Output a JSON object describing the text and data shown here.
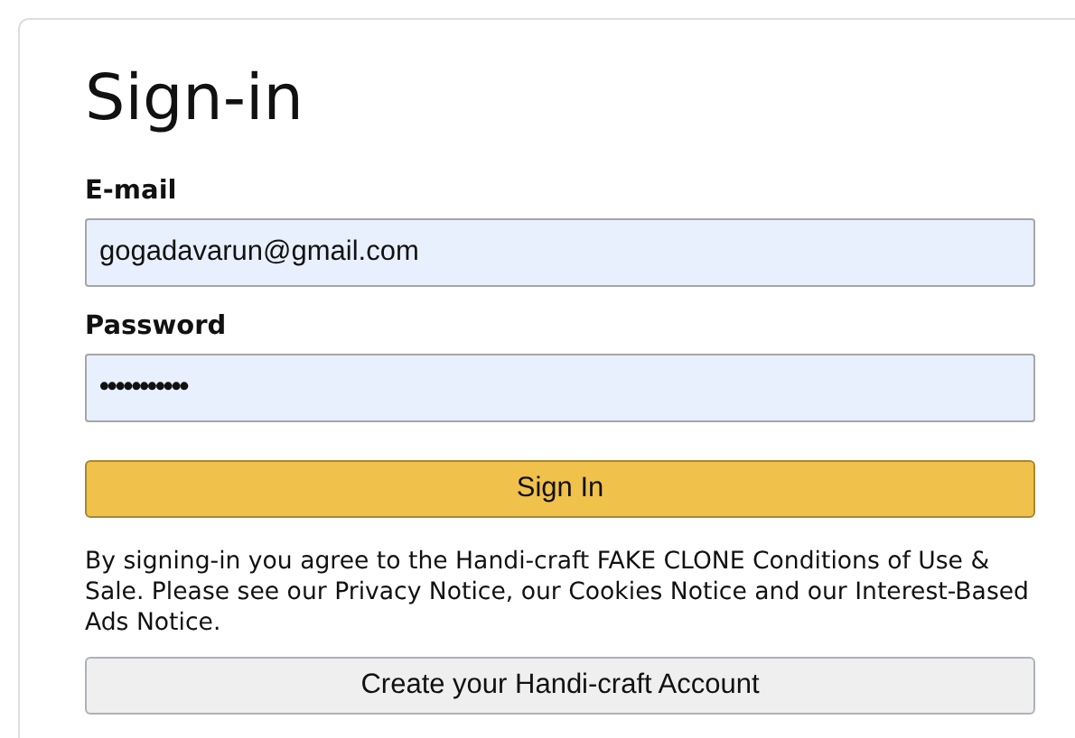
{
  "title": "Sign-in",
  "fields": [
    {
      "label": "E-mail",
      "value": "gogadavarun@gmail.com"
    },
    {
      "label": "Password",
      "value": "•••••••••••"
    }
  ],
  "sign_in_button": "Sign In",
  "agreement": "By signing-in you agree to the Handi-craft FAKE CLONE Conditions of Use & Sale. Please see our Privacy Notice, our Cookies Notice and our Interest-Based Ads Notice.",
  "create_account_button": "Create your Handi-craft Account"
}
